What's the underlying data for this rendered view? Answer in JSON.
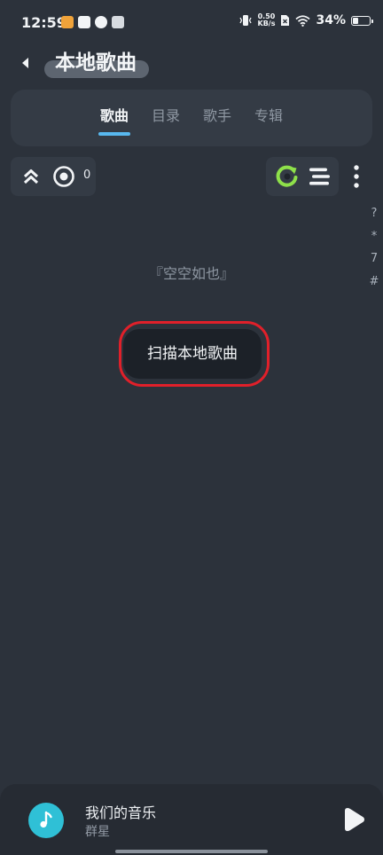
{
  "status_bar": {
    "time": "12:59",
    "net_speed_value": "0.50",
    "net_speed_unit": "KB/s",
    "battery_percent": "34%",
    "battery_level": 0.34
  },
  "header": {
    "title": "本地歌曲",
    "back_icon": "back-arrow-icon"
  },
  "tabs": [
    {
      "label": "歌曲",
      "active": true
    },
    {
      "label": "目录",
      "active": false
    },
    {
      "label": "歌手",
      "active": false
    },
    {
      "label": "专辑",
      "active": false
    }
  ],
  "toolbar": {
    "selected_count": "0",
    "accent_color": "#8ee04a"
  },
  "index_letters": [
    "?",
    "*",
    "7",
    "#"
  ],
  "empty_state": {
    "message": "『空空如也』",
    "scan_button_label": "扫描本地歌曲"
  },
  "player": {
    "track_title": "我们的音乐",
    "artist": "群星",
    "art_color": "#2fc0d6"
  },
  "colors": {
    "background": "#2c323b",
    "tab_underline": "#58b8ef",
    "highlight_ring": "#e0202a"
  }
}
